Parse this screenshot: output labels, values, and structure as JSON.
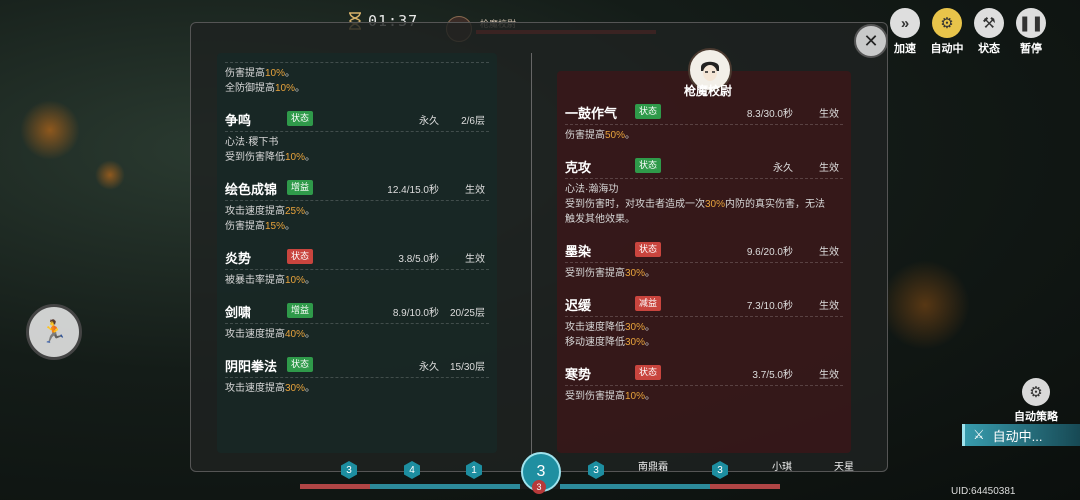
{
  "top": {
    "timer": "01:37",
    "boss_name_small": "枪魔校尉"
  },
  "buttons": {
    "speed": "加速",
    "auto": "自动中",
    "status": "状态",
    "pause": "暂停"
  },
  "left_buffs": {
    "intro_lines": [
      {
        "pre": "伤害提高",
        "val": "10%",
        "post": "。"
      },
      {
        "pre": "全防御提高",
        "val": "10%",
        "post": "。"
      }
    ],
    "items": [
      {
        "name": "争鸣",
        "tag": "状态",
        "tag_color": "green",
        "duration": "永久",
        "layers": "2/6层",
        "desc": [
          {
            "pre": "心法·稷下书",
            "val": "",
            "post": ""
          },
          {
            "pre": "受到伤害降低",
            "val": "10%",
            "post": "。"
          }
        ]
      },
      {
        "name": "绘色成锦",
        "tag": "增益",
        "tag_color": "green",
        "duration": "12.4/15.0秒",
        "layers": "生效",
        "desc": [
          {
            "pre": "攻击速度提高",
            "val": "25%",
            "post": "。"
          },
          {
            "pre": "伤害提高",
            "val": "15%",
            "post": "。"
          }
        ]
      },
      {
        "name": "炎势",
        "tag": "状态",
        "tag_color": "red",
        "duration": "3.8/5.0秒",
        "layers": "生效",
        "desc": [
          {
            "pre": "被暴击率提高",
            "val": "10%",
            "post": "。"
          }
        ]
      },
      {
        "name": "剑啸",
        "tag": "增益",
        "tag_color": "green",
        "duration": "8.9/10.0秒",
        "layers": "20/25层",
        "desc": [
          {
            "pre": "攻击速度提高",
            "val": "40%",
            "post": "。"
          }
        ]
      },
      {
        "name": "阴阳拳法",
        "tag": "状态",
        "tag_color": "green",
        "duration": "永久",
        "layers": "15/30层",
        "desc": [
          {
            "pre": "攻击速度提高",
            "val": "30%",
            "post": "。"
          }
        ]
      }
    ]
  },
  "boss": {
    "title": "枪魔校尉",
    "buffs": [
      {
        "name": "一鼓作气",
        "tag": "状态",
        "tag_color": "green",
        "duration": "8.3/30.0秒",
        "layers": "生效",
        "desc": [
          {
            "pre": "伤害提高",
            "val": "50%",
            "post": "。"
          }
        ]
      },
      {
        "name": "克攻",
        "tag": "状态",
        "tag_color": "green",
        "duration": "永久",
        "layers": "生效",
        "desc": [
          {
            "pre": "心法·瀚海功",
            "val": "",
            "post": ""
          },
          {
            "pre": "受到伤害时，对攻击者造成一次",
            "val": "30%",
            "post": "内防的真实伤害，无法"
          },
          {
            "pre": "触发其他效果。",
            "val": "",
            "post": ""
          }
        ]
      },
      {
        "name": "墨染",
        "tag": "状态",
        "tag_color": "red",
        "duration": "9.6/20.0秒",
        "layers": "生效",
        "desc": [
          {
            "pre": "受到伤害提高",
            "val": "30%",
            "post": "。"
          }
        ]
      },
      {
        "name": "迟缓",
        "tag": "减益",
        "tag_color": "red",
        "duration": "7.3/10.0秒",
        "layers": "生效",
        "desc": [
          {
            "pre": "攻击速度降低",
            "val": "30%",
            "post": "。"
          },
          {
            "pre": "移动速度降低",
            "val": "30%",
            "post": "。"
          }
        ]
      },
      {
        "name": "寒势",
        "tag": "状态",
        "tag_color": "red",
        "duration": "3.7/5.0秒",
        "layers": "生效",
        "desc": [
          {
            "pre": "受到伤害提高",
            "val": "10%",
            "post": "。"
          }
        ]
      }
    ]
  },
  "bottom": {
    "center_count": "3",
    "center_sub": "3",
    "gems": [
      "3",
      "4",
      "1",
      "3",
      "3"
    ],
    "labels": [
      "南鼎霜",
      "小琪",
      "天星"
    ]
  },
  "side": {
    "strategy": "自动策略",
    "auto_banner": "自动中..."
  },
  "uid": "UID:64450381",
  "colors": {
    "highlight": "#e8a33c",
    "green_tag": "#2f9a4a",
    "red_tag": "#c9453e"
  }
}
